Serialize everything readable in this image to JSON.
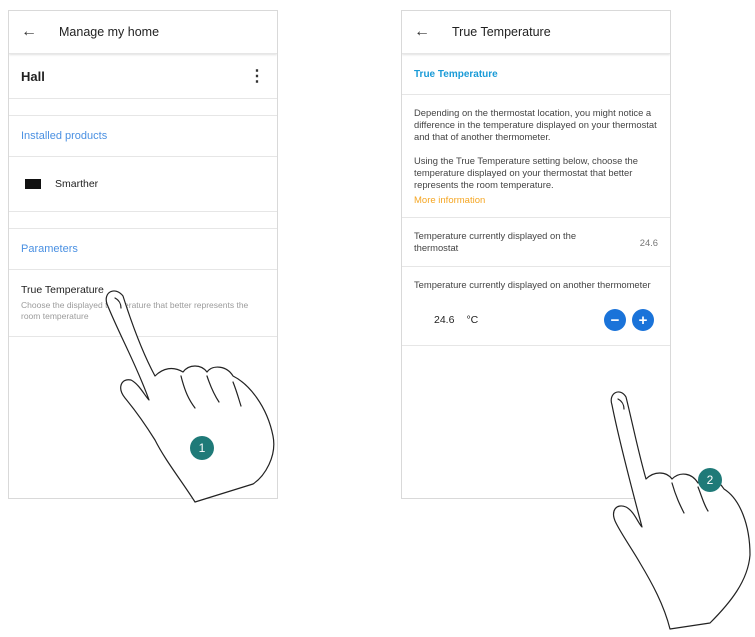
{
  "screen1": {
    "title": "Manage my home",
    "back_icon": "arrow-left-icon",
    "room": "Hall",
    "menu_icon": "kebab-menu-icon",
    "installed_products_label": "Installed products",
    "products": [
      {
        "name": "Smarther",
        "icon": "thermostat-device-icon"
      }
    ],
    "parameters_label": "Parameters",
    "parameter": {
      "title": "True Temperature",
      "description": "Choose the displayed temperature that better represents the room temperature"
    }
  },
  "screen2": {
    "title": "True Temperature",
    "section_header": "True Temperature",
    "paragraph1": "Depending on the thermostat location, you might notice a difference in the temperature displayed on your thermostat and that of another thermometer.",
    "paragraph2": "Using the True Temperature setting below, choose the temperature displayed on your thermostat that better represents the room temperature.",
    "more_info": "More information",
    "thermostat_label": "Temperature currently displayed on the thermostat",
    "thermostat_value": "24.6",
    "other_label": "Temperature currently displayed on another thermometer",
    "other_value": "24.6",
    "other_unit": "°C",
    "minus": "−",
    "plus": "+"
  },
  "steps": {
    "step1": "1",
    "step2": "2"
  },
  "colors": {
    "accent_blue": "#4a90e2",
    "header_blue": "#1a9bd7",
    "button_blue": "#1a73d9",
    "link_orange": "#f5a623",
    "badge_teal": "#1f7a78"
  }
}
